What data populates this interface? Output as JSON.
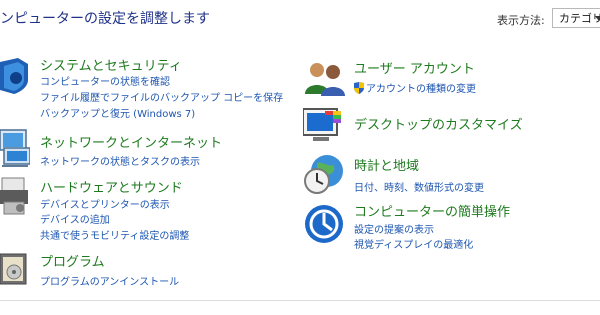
{
  "header": {
    "title": "ンピューターの設定を調整します",
    "view_by_label": "表示方法:",
    "view_by_value": "カテゴリ"
  },
  "left": {
    "system": {
      "title": "システムとセキュリティ",
      "links": [
        "コンピューターの状態を確認",
        "ファイル履歴でファイルのバックアップ コピーを保存",
        "バックアップと復元 (Windows 7)"
      ]
    },
    "network": {
      "title": "ネットワークとインターネット",
      "links": [
        "ネットワークの状態とタスクの表示"
      ]
    },
    "hardware": {
      "title": "ハードウェアとサウンド",
      "links": [
        "デバイスとプリンターの表示",
        "デバイスの追加",
        "共通で使うモビリティ設定の調整"
      ]
    },
    "programs": {
      "title": "プログラム",
      "links": [
        "プログラムのアンインストール"
      ]
    }
  },
  "right": {
    "user": {
      "title": "ユーザー アカウント",
      "links": [
        "アカウントの種類の変更"
      ]
    },
    "desktop": {
      "title": "デスクトップのカスタマイズ",
      "links": []
    },
    "clock": {
      "title": "時計と地域",
      "links": [
        "日付、時刻、数値形式の変更"
      ]
    },
    "ease": {
      "title": "コンピューターの簡単操作",
      "links": [
        "設定の提案の表示",
        "視覚ディスプレイの最適化"
      ]
    }
  }
}
